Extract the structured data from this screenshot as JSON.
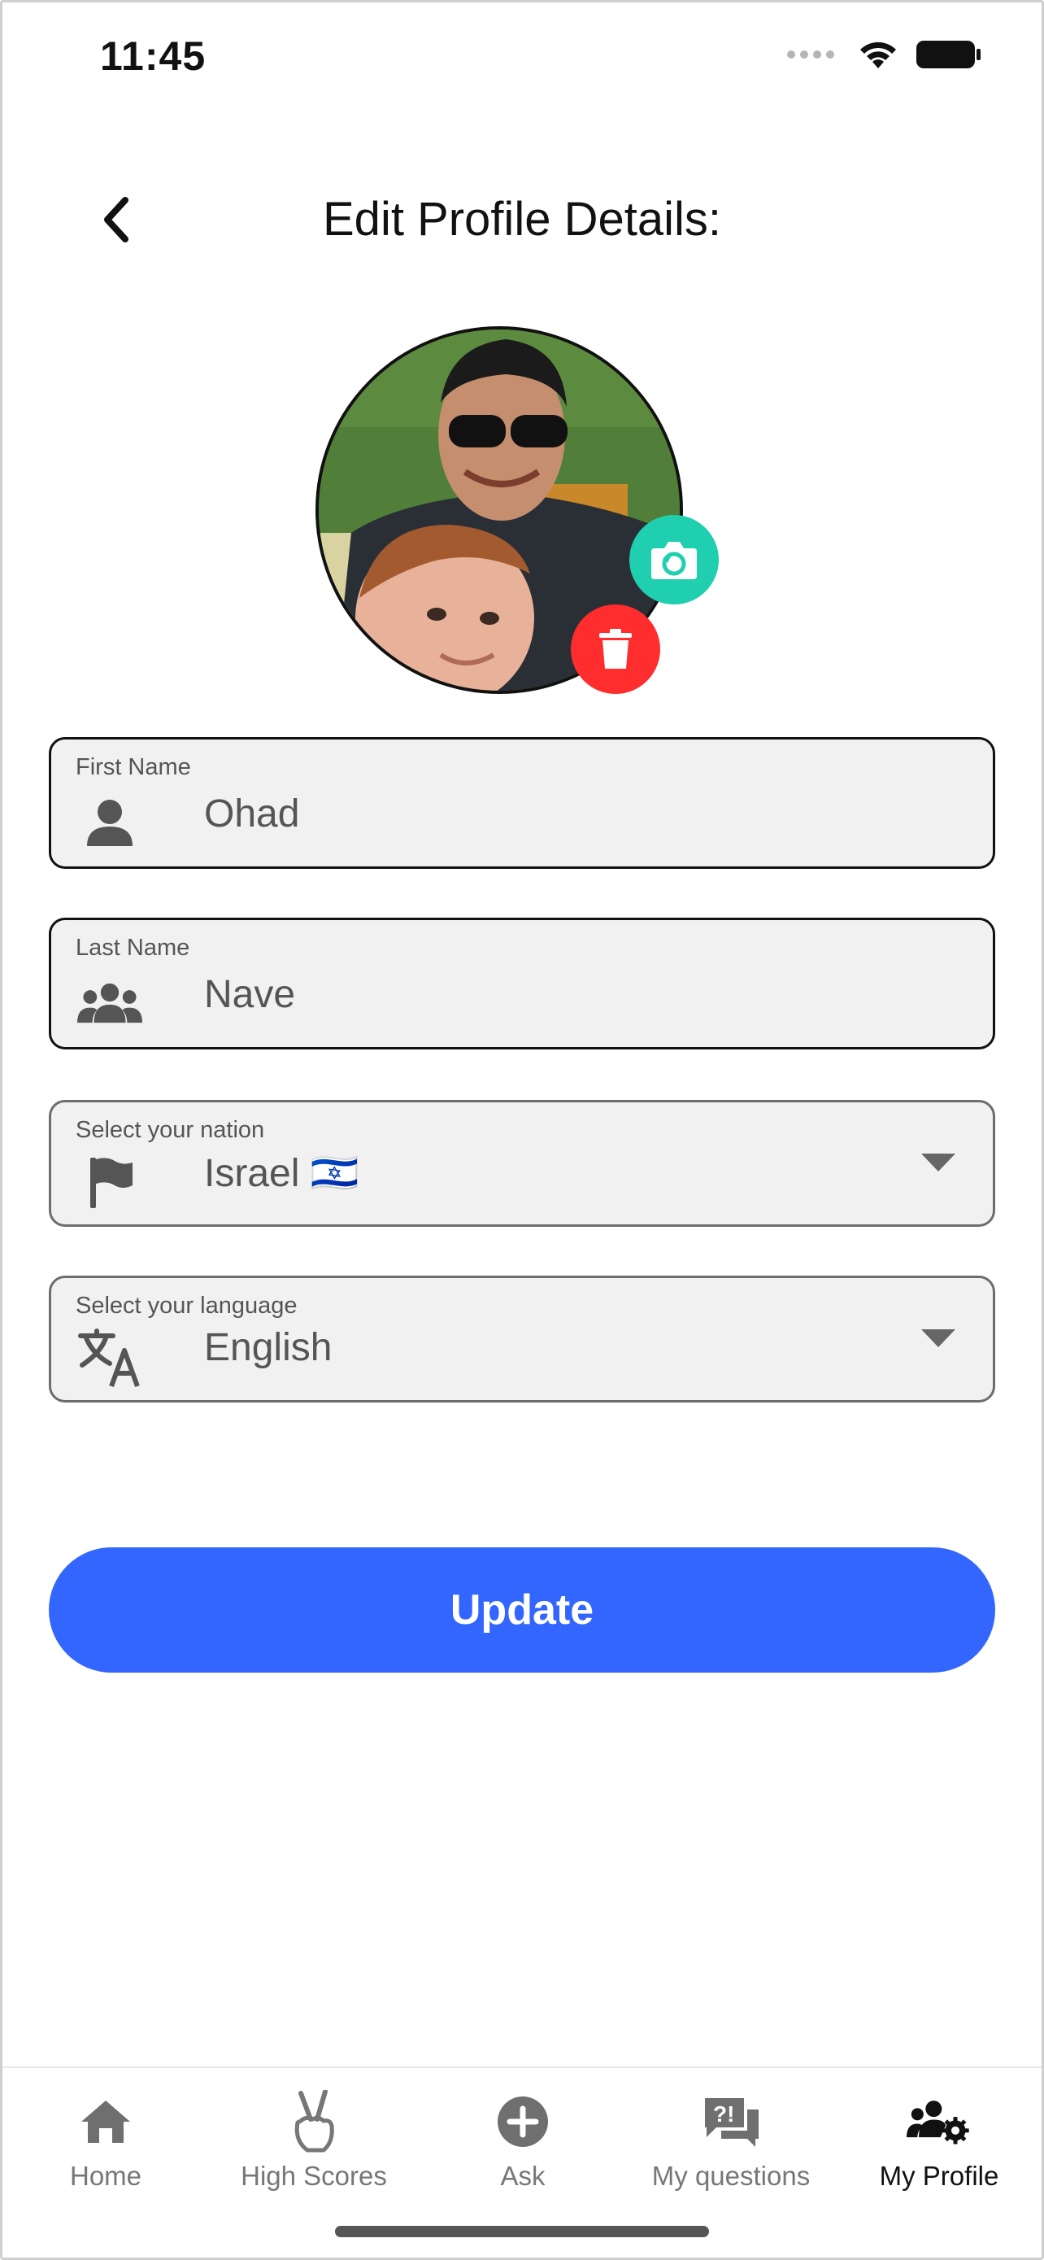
{
  "status_bar": {
    "time": "11:45"
  },
  "header": {
    "title": "Edit Profile Details:"
  },
  "avatar": {
    "alt": "Profile photo"
  },
  "fields": {
    "first_name": {
      "label": "First Name",
      "value": "Ohad",
      "icon": "person-icon"
    },
    "last_name": {
      "label": "Last Name",
      "value": "Nave",
      "icon": "group-icon"
    },
    "nation": {
      "label": "Select your nation",
      "value": "Israel 🇮🇱",
      "icon": "flag-icon"
    },
    "language": {
      "label": "Select your language",
      "value": "English",
      "icon": "translate-icon"
    }
  },
  "update_label": "Update",
  "tabs": [
    {
      "label": "Home",
      "icon": "home-icon",
      "active": false
    },
    {
      "label": "High Scores",
      "icon": "peace-hand-icon",
      "active": false
    },
    {
      "label": "Ask",
      "icon": "plus-circle-icon",
      "active": false
    },
    {
      "label": "My questions",
      "icon": "question-chat-icon",
      "active": false
    },
    {
      "label": "My Profile",
      "icon": "users-gear-icon",
      "active": true
    }
  ],
  "colors": {
    "primary": "#3366ff",
    "camera": "#1fcfb0",
    "delete": "#ff2d2d",
    "field_bg": "#f1f1f1"
  }
}
